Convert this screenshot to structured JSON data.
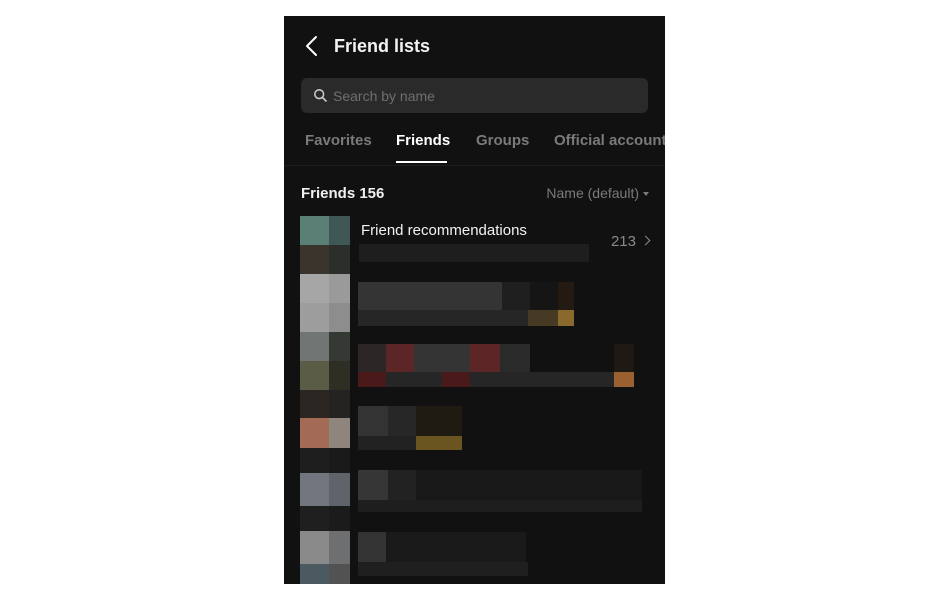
{
  "header": {
    "title": "Friend lists"
  },
  "search": {
    "placeholder": "Search by name"
  },
  "tabs": [
    {
      "label": "Favorites",
      "active": false
    },
    {
      "label": "Friends",
      "active": true
    },
    {
      "label": "Groups",
      "active": false
    },
    {
      "label": "Official accounts",
      "active": false
    }
  ],
  "section": {
    "title": "Friends 156",
    "sort_label": "Name (default)"
  },
  "recommendations": {
    "label": "Friend recommendations",
    "count": "213"
  },
  "icons": [
    "back-arrow-icon",
    "search-icon",
    "chevron-down-icon",
    "chevron-right-icon"
  ],
  "colors": {
    "background": "#111111",
    "search_bg": "#2a2a2a",
    "text_primary": "#ffffff",
    "text_secondary": "#7a7a7a"
  }
}
